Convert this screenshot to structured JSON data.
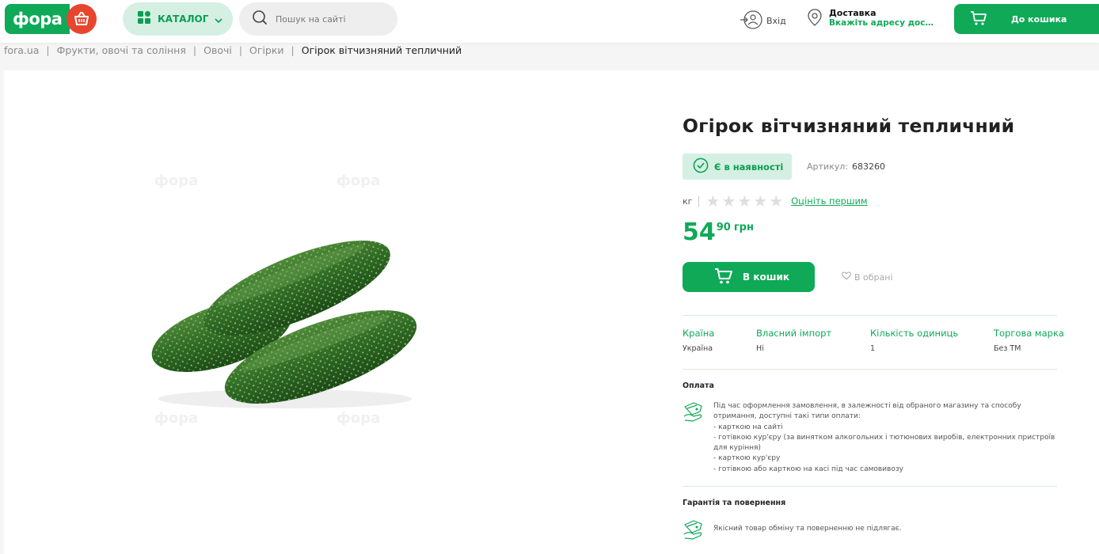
{
  "header": {
    "logo_text": "фора",
    "catalog_label": "КАТАЛОГ",
    "search_placeholder": "Пошук на сайті",
    "login_label": "Вхід",
    "delivery_title": "Доставка",
    "delivery_sub": "Вкажіть адресу доставки",
    "cart_label": "До кошика"
  },
  "breadcrumb": {
    "items": [
      "fora.ua",
      "Фрукти, овочі та соління",
      "Овочі",
      "Огірки"
    ],
    "current": "Огірок вітчизняний тепличний"
  },
  "product": {
    "title": "Огірок вітчизняний тепличний",
    "stock": "Є в наявності",
    "article_label": "Артикул:",
    "article": "683260",
    "unit": "кг",
    "rating": 0,
    "rate_link": "Оцініть першим",
    "price_int": "54",
    "price_dec": "90",
    "currency": "грн",
    "buy_label": "В кошик",
    "fav_label": "В обрані",
    "watermark": "фора"
  },
  "attributes": [
    {
      "label": "Країна",
      "value": "Україна"
    },
    {
      "label": "Власний імпорт",
      "value": "Ні"
    },
    {
      "label": "Кількість одиниць",
      "value": "1"
    },
    {
      "label": "Торгова марка",
      "value": "Без ТМ"
    }
  ],
  "payment": {
    "title": "Оплата",
    "lines": [
      "Під час оформлення замовлення, в залежності від обраного магазину та способу",
      "отримання, доступні такі типи оплати:",
      "- карткою на сайті",
      "- готівкою кур'єру (за винятком алкогольних і тютюнових виробів, електронних пристроїв",
      "для куріння)",
      "- карткою кур'єру",
      "- готівкою або карткою на касі під час самовивозу"
    ]
  },
  "guarantee": {
    "title": "Гарантія та повернення",
    "text": "Якісний товар обміну та поверненню не підлягає."
  },
  "colors": {
    "brand_green": "#0fa958",
    "light_green": "#d5f0e2",
    "brand_red": "#e8452f"
  }
}
